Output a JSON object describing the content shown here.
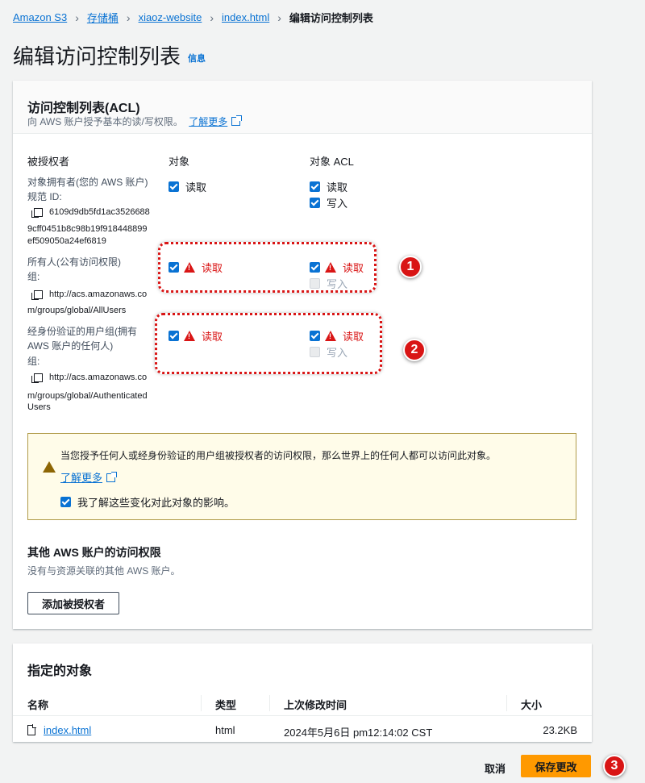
{
  "breadcrumb": {
    "items": [
      "Amazon S3",
      "存储桶",
      "xiaoz-website",
      "index.html"
    ],
    "current": "编辑访问控制列表"
  },
  "page": {
    "title": "编辑访问控制列表",
    "info": "信息"
  },
  "acl": {
    "title": "访问控制列表(ACL)",
    "description": "向 AWS 账户授予基本的读/写权限。",
    "learn_more": "了解更多",
    "columns": {
      "grantee": "被授权者",
      "object": "对象",
      "object_acl": "对象 ACL"
    },
    "owner": {
      "label": "对象拥有者(您的 AWS 账户)",
      "id_label": "规范 ID:",
      "id_line1": "6109d9db5fd1ac3526688",
      "id_line2": "9cff0451b8c98b19f918448899",
      "id_line3": "ef509050a24ef6819",
      "object_read": "读取",
      "acl_read": "读取",
      "acl_write": "写入"
    },
    "everyone": {
      "label": "所有人(公有访问权限)",
      "group_label": "组:",
      "uri_line1": "http://acs.amazonaws.co",
      "uri_line2": "m/groups/global/AllUsers",
      "object_read": "读取",
      "acl_read": "读取",
      "acl_write": "写入"
    },
    "authenticated": {
      "label_line1": "经身份验证的用户组(拥有",
      "label_line2": "AWS 账户的任何人)",
      "group_label": "组:",
      "uri_line1": "http://acs.amazonaws.co",
      "uri_line2": "m/groups/global/Authenticated",
      "uri_line3": "Users",
      "object_read": "读取",
      "acl_read": "读取",
      "acl_write": "写入"
    },
    "warning": {
      "text": "当您授予任何人或经身份验证的用户组被授权者的访问权限，那么世界上的任何人都可以访问此对象。",
      "learn_more": "了解更多",
      "ack": "我了解这些变化对此对象的影响。"
    },
    "other_accounts": {
      "title": "其他 AWS 账户的访问权限",
      "description": "没有与资源关联的其他 AWS 账户。",
      "add_button": "添加被授权者"
    }
  },
  "objects": {
    "title": "指定的对象",
    "headers": [
      "名称",
      "类型",
      "上次修改时间",
      "大小"
    ],
    "rows": [
      {
        "name": "index.html",
        "type": "html",
        "modified": "2024年5月6日 pm12:14:02 CST",
        "size": "23.2KB"
      }
    ]
  },
  "footer": {
    "cancel": "取消",
    "save": "保存更改"
  },
  "annotations": [
    "1",
    "2",
    "3"
  ],
  "colors": {
    "accent": "#0972d3",
    "danger": "#d91515",
    "primary": "#ff9900"
  }
}
